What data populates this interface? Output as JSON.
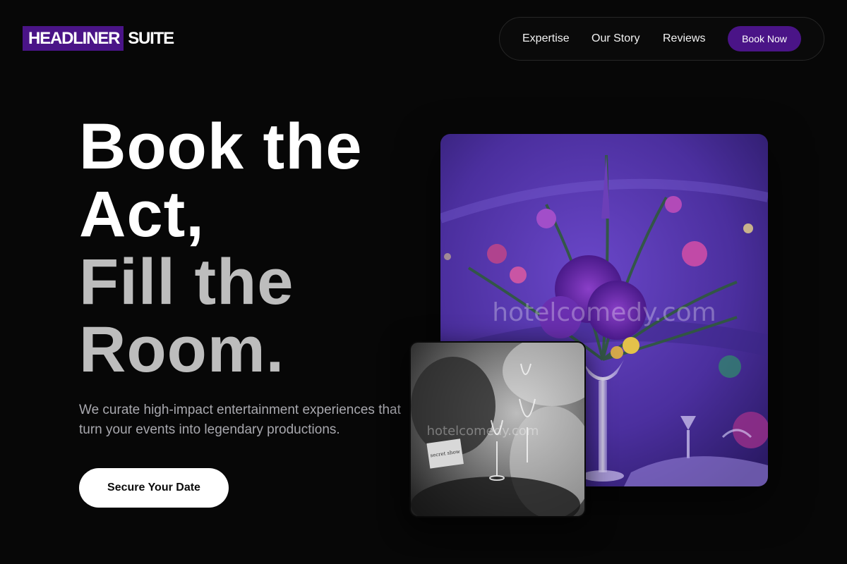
{
  "brand": {
    "highlight": "HEADLINER",
    "rest": "SUITE",
    "accent_color": "#4a1487"
  },
  "nav": {
    "links": [
      "Expertise",
      "Our Story",
      "Reviews"
    ],
    "cta_label": "Book Now"
  },
  "hero": {
    "headline_line1": "Book the",
    "headline_line2": "Act,",
    "headline_line3": "Fill the",
    "headline_line4": "Room.",
    "subtitle": "We curate high-impact entertainment experiences that turn your events into legendary productions.",
    "cta_label": "Secure Your Date"
  },
  "images": {
    "main_watermark": "hotelcomedy.com",
    "small_watermark": "hotelcomedy.com",
    "card_text": "secret show"
  }
}
